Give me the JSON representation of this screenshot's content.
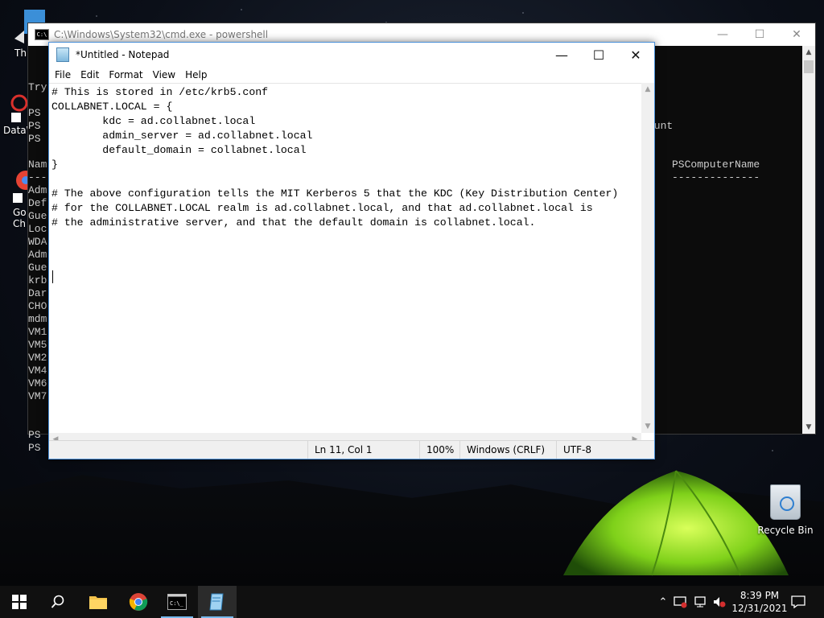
{
  "desktop": {
    "icons_left": [
      {
        "label": "Thi"
      },
      {
        "label": "DataW"
      },
      {
        "label": "Go"
      },
      {
        "label": "Ch"
      }
    ],
    "recycle_bin": {
      "label": "Recycle Bin",
      "icon": "recycle-bin-icon"
    }
  },
  "powershell": {
    "title": "C:\\Windows\\System32\\cmd.exe - powershell",
    "lines": [
      "Try",
      "",
      "PS",
      "PS",
      "PS",
      "",
      "Nam",
      "---",
      "Adm",
      "Def",
      "Gue",
      "Loc",
      "WDA",
      "Adm",
      "Gue",
      "krb",
      "Dar",
      "CHO",
      "mdm",
      "VM1",
      "VM5",
      "VM2",
      "VM4",
      "VM6",
      "VM7",
      "",
      "",
      "PS",
      "PS"
    ],
    "right_text": {
      "count_fragment": "ount",
      "column_header": "PSComputerName",
      "column_underline": "--------------"
    }
  },
  "notepad": {
    "title": "*Untitled - Notepad",
    "menu": [
      "File",
      "Edit",
      "Format",
      "View",
      "Help"
    ],
    "content": "# This is stored in /etc/krb5.conf\nCOLLABNET.LOCAL = {\n        kdc = ad.collabnet.local\n        admin_server = ad.collabnet.local\n        default_domain = collabnet.local\n}\n\n# The above configuration tells the MIT Kerberos 5 that the KDC (Key Distribution Center)\n# for the COLLABNET.LOCAL realm is ad.collabnet.local, and that ad.collabnet.local is\n# the administrative server, and that the default domain is collabnet.local.",
    "status": {
      "position": "Ln 11, Col 1",
      "zoom": "100%",
      "line_endings": "Windows (CRLF)",
      "encoding": "UTF-8"
    }
  },
  "taskbar": {
    "apps": [
      {
        "name": "start-button",
        "icon": "windows-logo-icon"
      },
      {
        "name": "search-button",
        "icon": "search-icon"
      },
      {
        "name": "file-explorer",
        "icon": "folder-icon"
      },
      {
        "name": "chrome",
        "icon": "chrome-icon"
      },
      {
        "name": "command-prompt",
        "icon": "cmd-icon"
      },
      {
        "name": "notepad",
        "icon": "notepad-icon",
        "active": true
      }
    ],
    "clock": {
      "time": "8:39 PM",
      "date": "12/31/2021"
    }
  }
}
